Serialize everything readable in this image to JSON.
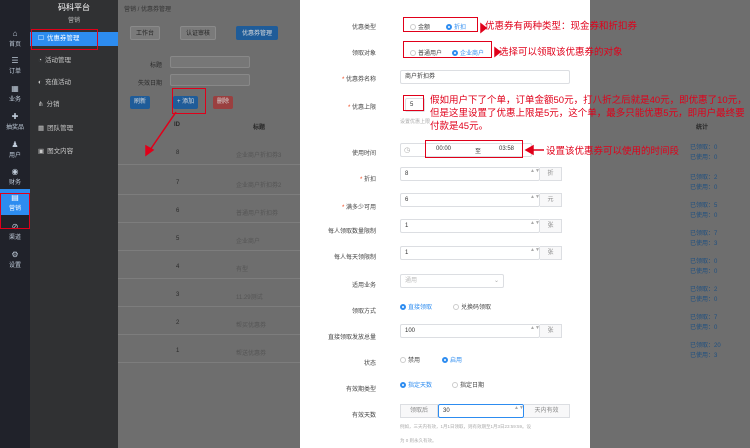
{
  "nav": {
    "items": [
      {
        "label": "首页",
        "icon": "home-icon",
        "glyph": "⌂"
      },
      {
        "label": "订单",
        "icon": "order-icon",
        "glyph": "☰"
      },
      {
        "label": "业务",
        "icon": "business-icon",
        "glyph": "▦"
      },
      {
        "label": "抽奖品",
        "icon": "prize-icon",
        "glyph": "✚"
      },
      {
        "label": "用户",
        "icon": "user-icon",
        "glyph": "♟"
      },
      {
        "label": "财务",
        "icon": "finance-icon",
        "glyph": "◉"
      },
      {
        "label": "营销",
        "icon": "marketing-icon",
        "glyph": "▤"
      },
      {
        "label": "渠道",
        "icon": "channel-icon",
        "glyph": "⊘"
      },
      {
        "label": "设置",
        "icon": "settings-icon",
        "glyph": "⚙"
      }
    ]
  },
  "subnav": {
    "title": "码科平台",
    "subtitle": "营销",
    "items": [
      {
        "label": "优惠券管理"
      },
      {
        "label": "活动管理"
      },
      {
        "label": "充值活动"
      },
      {
        "label": "分销"
      },
      {
        "label": "团队管理"
      },
      {
        "label": "图文内容"
      }
    ]
  },
  "content": {
    "breadcrumb": "营销 / 优惠券管理",
    "tabs": [
      "工作台",
      "认证审核",
      "优惠券管理"
    ],
    "filter_label_title": "标题",
    "filter_label_date": "失效日期",
    "btn_refresh": "刷新",
    "btn_add": "+ 添加",
    "btn_delete": "删除",
    "col_id": "ID",
    "col_title": "标题",
    "col_stats": "统计",
    "rows": [
      {
        "id": "8",
        "title": "企业商户折扣券3",
        "s1": "已领取：0",
        "s2": "已使用：0"
      },
      {
        "id": "7",
        "title": "企业商户折扣券2",
        "s1": "已领取：2",
        "s2": "已使用：0"
      },
      {
        "id": "6",
        "title": "普通用户折扣券",
        "s1": "已领取：5",
        "s2": "已使用：0"
      },
      {
        "id": "5",
        "title": "企业商户",
        "s1": "已领取：7",
        "s2": "已使用：3"
      },
      {
        "id": "4",
        "title": "有型",
        "s1": "已领取：0",
        "s2": "已使用：0"
      },
      {
        "id": "3",
        "title": "11.29测试",
        "s1": "已领取：2",
        "s2": "已使用：0"
      },
      {
        "id": "2",
        "title": "帮买优惠券",
        "s1": "已领取：7",
        "s2": "已使用：0"
      },
      {
        "id": "1",
        "title": "帮送优惠券",
        "s1": "已领取：20",
        "s2": "已使用：3"
      }
    ]
  },
  "form": {
    "type_label": "优惠类型",
    "type_opt_cash": "金额",
    "type_opt_discount": "折扣",
    "target_label": "领取对象",
    "target_opt_normal": "普通用户",
    "target_opt_company": "企业商户",
    "name_label": "优惠券名称",
    "name_value": "商户折扣券",
    "cap_label": "优惠上限",
    "cap_value": "5",
    "cap_hint": "设置优惠上限",
    "time_label": "使用时间",
    "time_start": "00:00",
    "time_sep": "至",
    "time_end": "03:58",
    "discount_label": "折扣",
    "discount_value": "8",
    "discount_unit": "折",
    "min_label": "满多少可用",
    "min_value": "6",
    "min_unit": "元",
    "per_user_label": "每人领取数量限制",
    "per_user_value": "1",
    "per_user_unit": "张",
    "per_day_label": "每人每天领限制",
    "per_day_value": "1",
    "per_day_unit": "张",
    "biz_label": "适用业务",
    "biz_placeholder": "通用",
    "method_label": "领取方式",
    "method_opt_direct": "直接领取",
    "method_opt_code": "兑换码领取",
    "total_label": "直接领取发放总量",
    "total_value": "100",
    "total_unit": "张",
    "status_label": "状态",
    "status_opt_off": "禁用",
    "status_opt_on": "启用",
    "validity_label": "有效期类型",
    "validity_opt_days": "指定天数",
    "validity_opt_date": "指定日期",
    "days_label": "有效天数",
    "days_prefix": "领取后",
    "days_value": "30",
    "days_suffix": "天内有效",
    "days_hint": "例如，三天内有效，1月1日领取，则有效期至1月3日23:59:59。设",
    "days_hint2": "为 0 则永久有效。"
  },
  "annotations": {
    "type_note": "优惠券有两种类型：现金券和折扣券",
    "target_note": "选择可以领取该优惠券的对象",
    "cap_note": "假如用户下了个单，订单金额50元，打八折之后就是40元，即优惠了10元，但是这里设置了优惠上限是5元，这个单，最多只能优惠5元，即用户最终要付款是45元。",
    "time_note": "设置该优惠券可以使用的时间段"
  },
  "colors": {
    "primary": "#2d8cf0",
    "annotation": "#e0001a",
    "nav_bg": "#20222a"
  }
}
